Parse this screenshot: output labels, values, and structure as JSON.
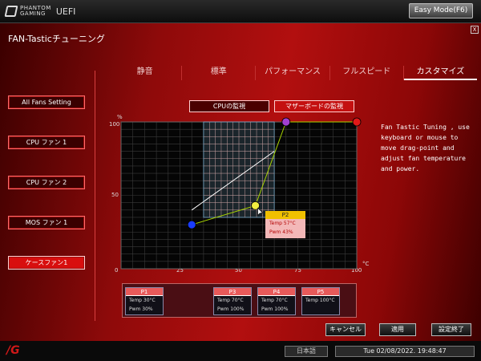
{
  "topbar": {
    "brand_line1": "PHANTOM",
    "brand_line2": "GAMING",
    "uefi": "UEFI",
    "easy_mode": "Easy Mode(F6)"
  },
  "page_title": "FAN-Tasticチューニング",
  "close_label": "X",
  "tabs": [
    {
      "label": "静音",
      "active": false
    },
    {
      "label": "標準",
      "active": false
    },
    {
      "label": "パフォーマンス",
      "active": false
    },
    {
      "label": "フルスピード",
      "active": false
    },
    {
      "label": "カスタマイズ",
      "active": true
    }
  ],
  "fans": [
    {
      "label": "All Fans Setting",
      "selected": false
    },
    {
      "label": "CPU ファン 1",
      "selected": false
    },
    {
      "label": "CPU ファン 2",
      "selected": false
    },
    {
      "label": "MOS ファン 1",
      "selected": false
    },
    {
      "label": "ケースファン1",
      "selected": true
    }
  ],
  "monitor": {
    "cpu": "CPUの監視",
    "mb": "マザーボードの監視"
  },
  "chart": {
    "y_unit": "%",
    "x_unit": "°C",
    "y_ticks": [
      "100",
      "50",
      "0"
    ],
    "x_ticks": [
      "25",
      "50",
      "75",
      "100"
    ]
  },
  "chart_data": {
    "type": "line",
    "x_range": [
      0,
      100
    ],
    "y_range": [
      0,
      100
    ],
    "series": [
      {
        "points": [
          [
            30,
            30
          ],
          [
            57,
            43
          ],
          [
            70,
            100
          ],
          [
            100,
            100
          ]
        ],
        "color": "#a8d400"
      },
      {
        "points": [
          [
            30,
            40
          ],
          [
            65,
            80
          ]
        ],
        "color": "#ffffff"
      }
    ],
    "handles": [
      {
        "x": 30,
        "y": 30,
        "color": "#1a3cff"
      },
      {
        "x": 57,
        "y": 43,
        "color": "#f2ee40"
      },
      {
        "x": 70,
        "y": 100,
        "color": "#a040d0"
      },
      {
        "x": 100,
        "y": 100,
        "color": "#e01818"
      }
    ],
    "highlight_box": {
      "x": [
        35,
        65
      ],
      "y": [
        35,
        100
      ]
    }
  },
  "tooltip": {
    "title": "P2",
    "temp": "Temp 57°C",
    "pwm": "Pwm  43%"
  },
  "help_text": "Fan Tastic Tuning , use keyboard or mouse to move drag-point and adjust fan temperature and power.",
  "points": [
    {
      "title": "P1",
      "temp": "Temp 30°C",
      "pwm": "Pwm  30%"
    },
    {
      "title": "P3",
      "temp": "Temp 70°C",
      "pwm": "Pwm  100%"
    },
    {
      "title": "P4",
      "temp": "Temp 70°C",
      "pwm": "Pwm  100%"
    },
    {
      "title": "P5",
      "temp": "Temp 100°C",
      "pwm": ""
    }
  ],
  "buttons": {
    "cancel": "キャンセル",
    "apply": "適用",
    "save_exit": "設定終了"
  },
  "status": {
    "language": "日本語",
    "datetime": "Tue 02/08/2022. 19:48:47"
  }
}
